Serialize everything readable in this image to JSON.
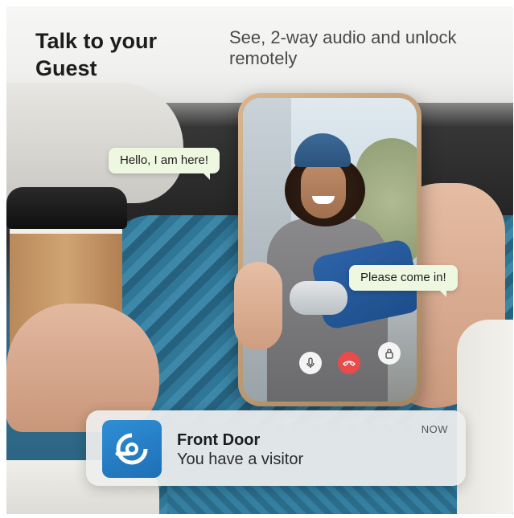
{
  "headline": "Talk to your Guest",
  "subheadline": "See, 2-way audio and unlock remotely",
  "chat": {
    "guest_message": "Hello, I am here!",
    "host_message": "Please come in!"
  },
  "call_controls": {
    "mic_icon": "microphone-icon",
    "end_call_icon": "end-call-icon",
    "unlock_icon": "lock-icon",
    "end_call_color": "#e84b4b"
  },
  "notification": {
    "title": "Front Door",
    "message": "You have a visitor",
    "time": "NOW",
    "app_icon": "doorbell-app-icon",
    "icon_color": "#2e8fd6"
  }
}
